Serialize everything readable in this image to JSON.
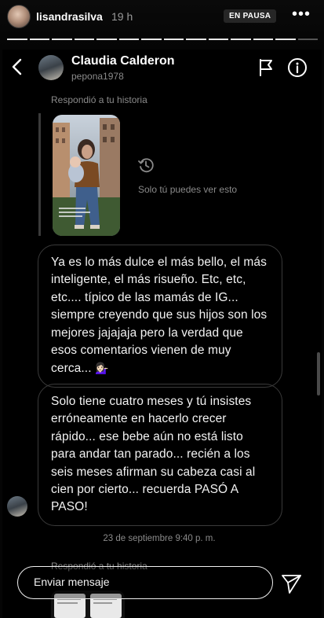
{
  "story": {
    "username": "lisandrasilva",
    "time": "19 h",
    "paused_badge": "EN PAUSA",
    "more_label": "•••",
    "segments_done": 13,
    "segments_total": 14
  },
  "dm": {
    "contact_name": "Claudia Calderon",
    "contact_handle": "pepona1978",
    "replied_label": "Respondió a tu historia",
    "only_you_label": "Solo tú puedes ver esto",
    "messages": [
      {
        "text": "Ya es lo más dulce el más bello, el más inteligente, el más risueño. Etc, etc, etc.... típico de las mamás de IG... siempre creyendo que sus hijos son los mejores jajajaja pero la verdad que esos comentarios vienen de muy cerca...",
        "emoji": "💁🏻‍♀️"
      },
      {
        "text": "Solo tiene cuatro meses y tú insistes erróneamente en hacerlo crecer rápido... ese bebe aún no está listo para andar tan parado... recién a los seis meses afirman su cabeza casi al cien por cierto... recuerda PASÓ A PASO!"
      }
    ],
    "date_separator": "23 de septiembre 9:40 p. m.",
    "replied_label_2": "Respondió a tu historia"
  },
  "reply_bar": {
    "placeholder": "Enviar mensaje"
  },
  "icons": {
    "back": "chevron-left-icon",
    "flag": "flag-icon",
    "info": "info-icon",
    "history": "history-icon",
    "send": "send-icon"
  },
  "colors": {
    "background": "#000000",
    "bubble_border": "#3a3a3a",
    "secondary_text": "#8a8a8a",
    "progress_done": "#e8e8e8",
    "paused_badge_bg": "#262626"
  }
}
